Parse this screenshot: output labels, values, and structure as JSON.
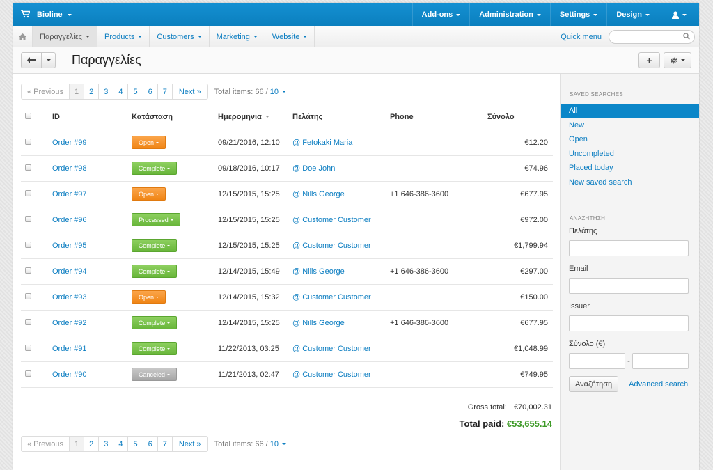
{
  "topbar": {
    "brand": "Bioline",
    "menus": [
      "Add-ons",
      "Administration",
      "Settings",
      "Design"
    ]
  },
  "nav": {
    "items": [
      "Παραγγελίες",
      "Products",
      "Customers",
      "Marketing",
      "Website"
    ],
    "quick_menu": "Quick menu",
    "search_placeholder": ""
  },
  "title": "Παραγγελίες",
  "pagination": {
    "previous": "« Previous",
    "pages": [
      "1",
      "2",
      "3",
      "4",
      "5",
      "6",
      "7"
    ],
    "next": "Next »",
    "total_label": "Total items: 66 / ",
    "per_page": "10"
  },
  "table": {
    "headers": {
      "id": "ID",
      "status": "Κατάσταση",
      "date": "Ημερομηνια",
      "customer": "Πελάτης",
      "phone": "Phone",
      "total": "Σύνολο"
    },
    "rows": [
      {
        "id": "Order #99",
        "status": "Open",
        "status_type": "open",
        "date": "09/21/2016, 12:10",
        "customer": "@ Fetokaki Maria",
        "phone": "",
        "total": "€12.20"
      },
      {
        "id": "Order #98",
        "status": "Complete",
        "status_type": "complete",
        "date": "09/18/2016, 10:17",
        "customer": "@ Doe John",
        "phone": "",
        "total": "€74.96"
      },
      {
        "id": "Order #97",
        "status": "Open",
        "status_type": "open",
        "date": "12/15/2015, 15:25",
        "customer": "@ Nills George",
        "phone": "+1 646-386-3600",
        "total": "€677.95"
      },
      {
        "id": "Order #96",
        "status": "Processed",
        "status_type": "processed",
        "date": "12/15/2015, 15:25",
        "customer": "@ Customer Customer",
        "phone": "",
        "total": "€972.00"
      },
      {
        "id": "Order #95",
        "status": "Complete",
        "status_type": "complete",
        "date": "12/15/2015, 15:25",
        "customer": "@ Customer Customer",
        "phone": "",
        "total": "€1,799.94"
      },
      {
        "id": "Order #94",
        "status": "Complete",
        "status_type": "complete",
        "date": "12/14/2015, 15:49",
        "customer": "@ Nills George",
        "phone": "+1 646-386-3600",
        "total": "€297.00"
      },
      {
        "id": "Order #93",
        "status": "Open",
        "status_type": "open",
        "date": "12/14/2015, 15:32",
        "customer": "@ Customer Customer",
        "phone": "",
        "total": "€150.00"
      },
      {
        "id": "Order #92",
        "status": "Complete",
        "status_type": "complete",
        "date": "12/14/2015, 15:25",
        "customer": "@ Nills George",
        "phone": "+1 646-386-3600",
        "total": "€677.95"
      },
      {
        "id": "Order #91",
        "status": "Complete",
        "status_type": "complete",
        "date": "11/22/2013, 03:25",
        "customer": "@ Customer Customer",
        "phone": "",
        "total": "€1,048.99"
      },
      {
        "id": "Order #90",
        "status": "Canceled",
        "status_type": "canceled",
        "date": "11/21/2013, 02:47",
        "customer": "@ Customer Customer",
        "phone": "",
        "total": "€749.95"
      }
    ]
  },
  "totals": {
    "gross_label": "Gross total:",
    "gross_value": "€70,002.31",
    "paid_label": "Total paid:",
    "paid_value": "€53,655.14"
  },
  "sidebar": {
    "saved_title": "SAVED SEARCHES",
    "saved": [
      "All",
      "New",
      "Open",
      "Uncompleted",
      "Placed today",
      "New saved search"
    ],
    "search_title": "ΑΝΑΖΗΤΗΣΗ",
    "fields": {
      "customer": "Πελάτης",
      "email": "Email",
      "issuer": "Issuer",
      "total": "Σύνολο (€)"
    },
    "search_button": "Αναζήτηση",
    "advanced": "Advanced search"
  },
  "colors": {
    "brand": "#0b86c8",
    "link": "#0b7dc1",
    "open": "#f08515",
    "complete": "#68b63a",
    "canceled": "#a6a6a6",
    "paid": "#3d9a26"
  }
}
